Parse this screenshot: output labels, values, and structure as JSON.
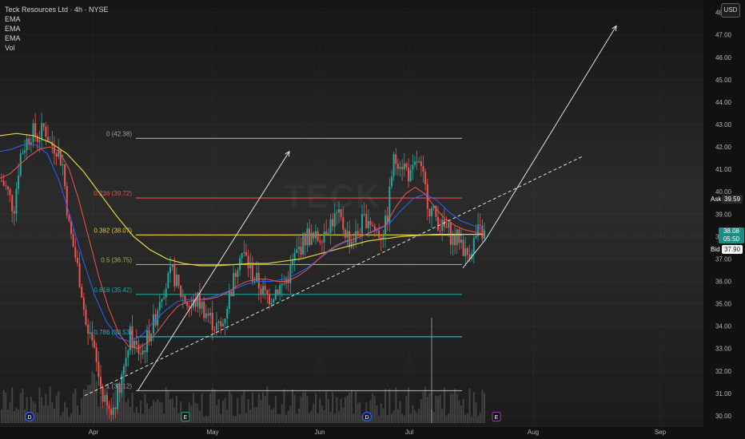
{
  "header": {
    "symbol_title": "Teck Resources Ltd · 4h · NYSE",
    "indicators": [
      "EMA",
      "EMA",
      "EMA",
      "Vol"
    ],
    "currency_button": "USD"
  },
  "watermark": "TECK",
  "price_axis": {
    "ticks": [
      "48.00",
      "47.00",
      "46.00",
      "45.00",
      "44.00",
      "43.00",
      "42.00",
      "41.00",
      "40.00",
      "39.00",
      "38.00",
      "37.00",
      "36.00",
      "35.00",
      "34.00",
      "33.00",
      "32.00",
      "31.00",
      "30.00"
    ],
    "ask_label": "Ask",
    "ask_value": "39.59",
    "last_price": "38.08",
    "countdown": "05:50",
    "bid_label": "Bid",
    "bid_value": "37.90"
  },
  "time_axis": {
    "labels": [
      "Apr",
      "May",
      "Jun",
      "Jul",
      "Aug",
      "Sep"
    ]
  },
  "fibonacci": [
    {
      "label": "0 (42.38)",
      "price": 42.38,
      "color": "#9e9e9e"
    },
    {
      "label": "0.236 (39.72)",
      "price": 39.72,
      "color": "#e5484d"
    },
    {
      "label": "0.382 (38.07)",
      "price": 38.07,
      "color": "#e0c43a"
    },
    {
      "label": "0.5 (36.75)",
      "price": 36.75,
      "color": "#8fbf3a"
    },
    {
      "label": "0.618 (35.42)",
      "price": 35.42,
      "color": "#1ba79a"
    },
    {
      "label": "0.786 (33.53)",
      "price": 33.53,
      "color": "#1fb5c9"
    },
    {
      "label": "1 (31.12)",
      "price": 31.12,
      "color": "#9e9e9e"
    }
  ],
  "event_badges": [
    {
      "text": "D",
      "color": "#2962ff"
    },
    {
      "text": "E",
      "color": "#1b9e6b"
    },
    {
      "text": "E",
      "color": "#1b9e6b"
    },
    {
      "text": "D",
      "color": "#2962ff"
    },
    {
      "text": "E",
      "color": "#9c27b0"
    }
  ],
  "colors": {
    "up": "#26a69a",
    "down": "#ef5350",
    "ema_fast": "#ef5350",
    "ema_mid": "#2962ff",
    "ema_slow": "#e0d33a"
  },
  "chart_data": {
    "type": "candlestick",
    "symbol": "Teck Resources Ltd",
    "interval": "4h",
    "exchange": "NYSE",
    "ylim": [
      29.5,
      48.2
    ],
    "x_labels": [
      "Apr",
      "May",
      "Jun",
      "Jul",
      "Aug",
      "Sep"
    ],
    "close_path": [
      40.5,
      40.0,
      39.2,
      41.6,
      42.2,
      42.7,
      42.4,
      42.9,
      42.1,
      42.0,
      41.2,
      38.5,
      37.2,
      35.8,
      33.6,
      33.0,
      31.6,
      30.4,
      30.1,
      31.1,
      32.2,
      33.6,
      33.0,
      32.8,
      33.6,
      34.2,
      35.5,
      35.9,
      36.4,
      35.6,
      35.2,
      34.8,
      35.2,
      34.8,
      34.4,
      34.0,
      33.9,
      35.1,
      36.1,
      37.4,
      37.0,
      36.3,
      35.9,
      35.4,
      35.3,
      35.7,
      35.8,
      36.3,
      37.1,
      37.6,
      38.1,
      37.8,
      38.0,
      38.4,
      38.7,
      38.9,
      38.4,
      37.8,
      38.0,
      38.6,
      38.9,
      38.3,
      38.1,
      38.6,
      41.3,
      41.5,
      41.1,
      40.6,
      41.4,
      40.5,
      39.3,
      38.9,
      38.4,
      38.3,
      37.8,
      38.0,
      37.1,
      37.6,
      38.2,
      38.08
    ],
    "ema_fast_path": [
      40.6,
      40.8,
      41.2,
      41.6,
      41.9,
      42.0,
      41.8,
      41.0,
      39.6,
      37.9,
      36.2,
      34.8,
      33.7,
      33.1,
      33.0,
      33.3,
      33.8,
      34.4,
      34.9,
      35.1,
      35.2,
      35.2,
      35.3,
      35.5,
      35.8,
      36.0,
      36.1,
      36.1,
      36.0,
      36.0,
      36.2,
      36.5,
      36.9,
      37.3,
      37.6,
      37.8,
      37.9,
      38.1,
      38.3,
      38.5,
      39.3,
      39.9,
      40.2,
      39.9,
      39.3,
      38.8,
      38.5,
      38.3,
      38.2,
      38.1
    ],
    "ema_mid_path": [
      41.8,
      41.9,
      42.1,
      42.1,
      41.7,
      40.5,
      38.8,
      37.0,
      35.4,
      34.2,
      33.5,
      33.3,
      33.6,
      34.2,
      34.7,
      35.1,
      35.2,
      35.2,
      35.3,
      35.5,
      35.7,
      35.9,
      36.0,
      36.0,
      36.1,
      36.3,
      36.6,
      37.0,
      37.4,
      37.7,
      37.9,
      38.1,
      38.3,
      38.6,
      39.2,
      39.7,
      39.9,
      39.6,
      39.1,
      38.7,
      38.5,
      38.3
    ],
    "ema_slow_path": [
      42.5,
      42.6,
      42.5,
      42.2,
      41.7,
      40.9,
      39.9,
      38.9,
      38.0,
      37.4,
      37.0,
      36.8,
      36.7,
      36.7,
      36.75,
      36.8,
      36.8,
      36.9,
      37.0,
      37.2,
      37.4,
      37.6,
      37.8,
      37.9,
      38.0,
      38.05,
      38.1,
      38.1,
      38.1,
      38.1
    ],
    "trendlines": {
      "dashed_support": {
        "from": 30.9,
        "to": 41.6
      },
      "projection_arrow_target": 47.4,
      "measured_move_arrow_target": 41.8
    }
  }
}
